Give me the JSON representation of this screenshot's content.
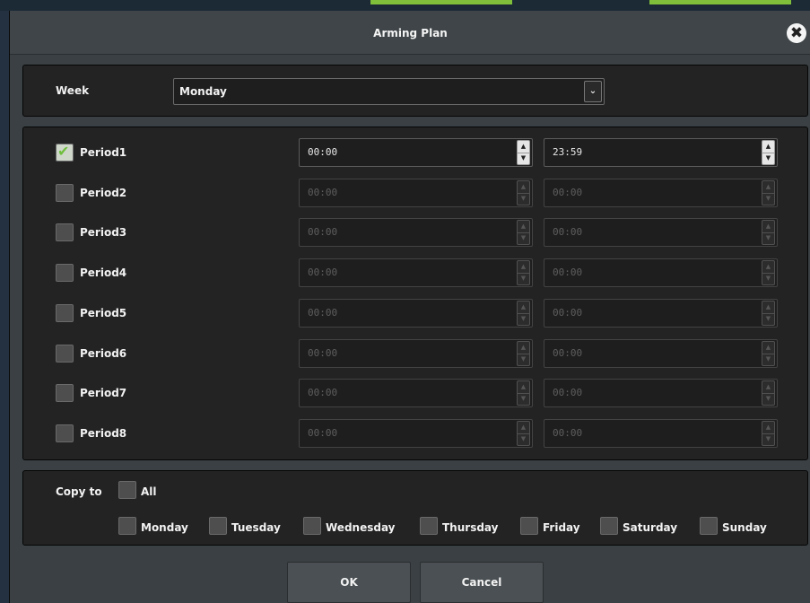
{
  "dialog": {
    "title": "Arming Plan",
    "close_icon": "close-icon"
  },
  "week": {
    "label": "Week",
    "selected": "Monday"
  },
  "periods": [
    {
      "label": "Period1",
      "checked": true,
      "start": "00:00",
      "end": "23:59",
      "enabled": true
    },
    {
      "label": "Period2",
      "checked": false,
      "start": "00:00",
      "end": "00:00",
      "enabled": false
    },
    {
      "label": "Period3",
      "checked": false,
      "start": "00:00",
      "end": "00:00",
      "enabled": false
    },
    {
      "label": "Period4",
      "checked": false,
      "start": "00:00",
      "end": "00:00",
      "enabled": false
    },
    {
      "label": "Period5",
      "checked": false,
      "start": "00:00",
      "end": "00:00",
      "enabled": false
    },
    {
      "label": "Period6",
      "checked": false,
      "start": "00:00",
      "end": "00:00",
      "enabled": false
    },
    {
      "label": "Period7",
      "checked": false,
      "start": "00:00",
      "end": "00:00",
      "enabled": false
    },
    {
      "label": "Period8",
      "checked": false,
      "start": "00:00",
      "end": "00:00",
      "enabled": false
    }
  ],
  "copy": {
    "label": "Copy to",
    "all_label": "All",
    "days": [
      "Monday",
      "Tuesday",
      "Wednesday",
      "Thursday",
      "Friday",
      "Saturday",
      "Sunday"
    ]
  },
  "buttons": {
    "ok": "OK",
    "cancel": "Cancel"
  },
  "colors": {
    "check_green": "#6fbf3e",
    "panel_bg": "#232323",
    "dialog_bg": "#3a4043"
  }
}
